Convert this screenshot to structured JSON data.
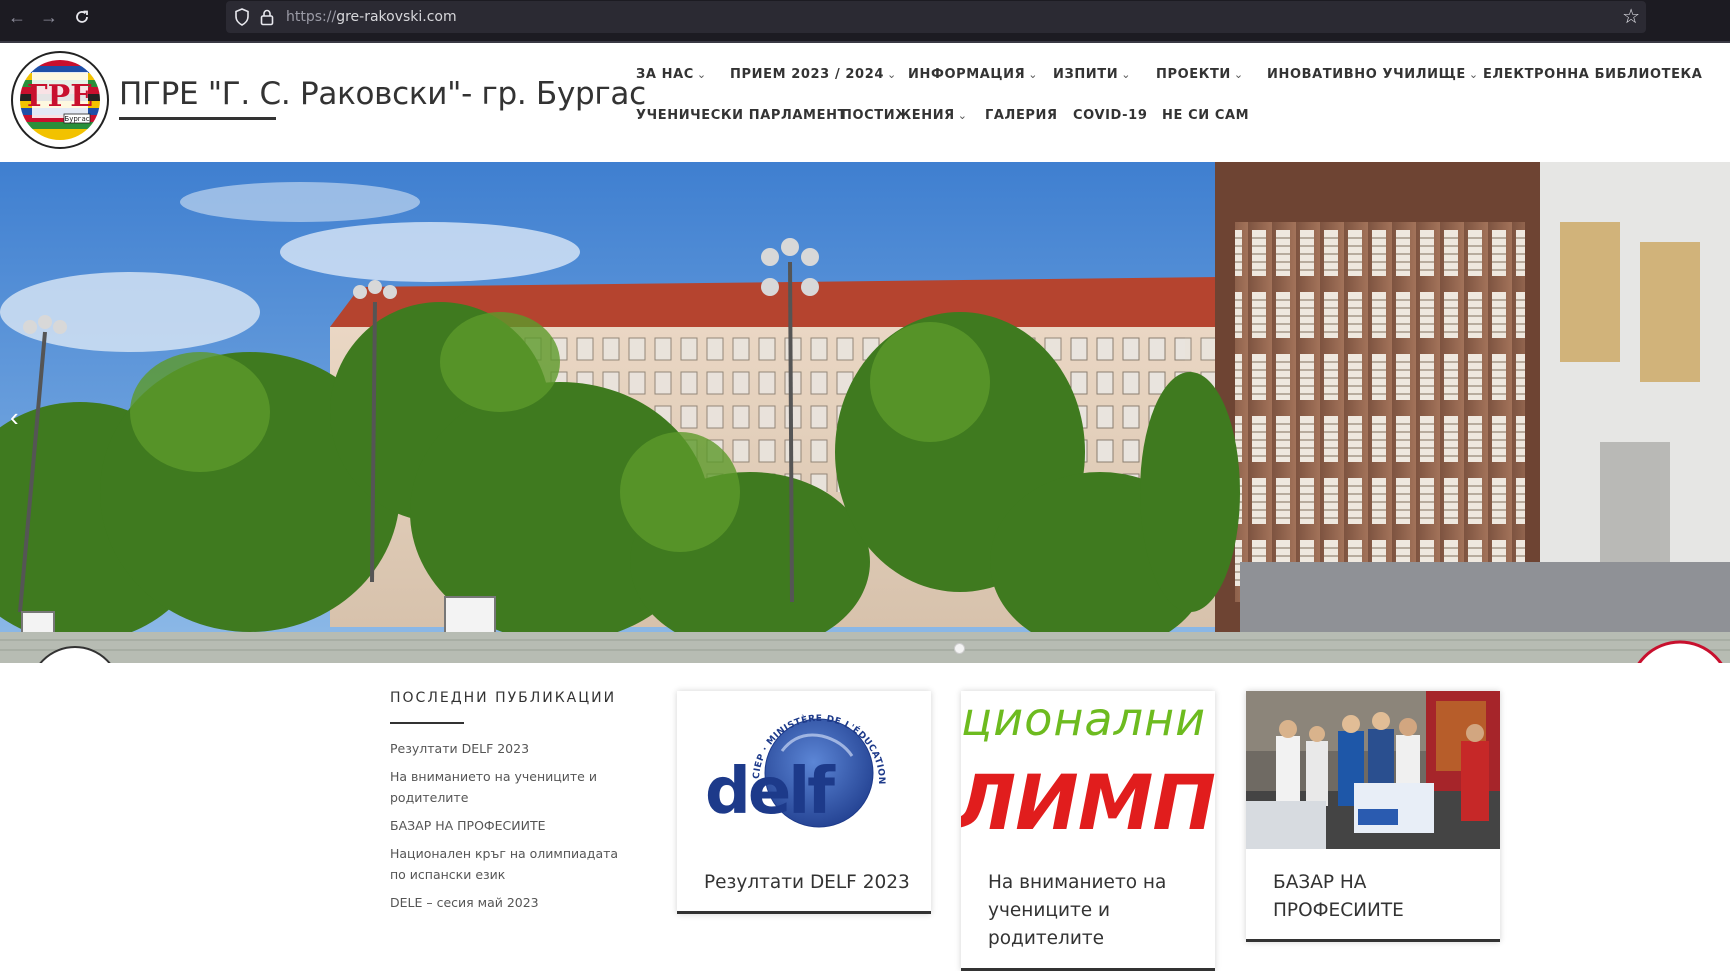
{
  "browser": {
    "url_protocol": "https://",
    "url_domain": "gre-rakovski.com",
    "icons": {
      "back": "arrow-left-icon",
      "forward": "arrow-right-icon",
      "reload": "reload-icon",
      "shield": "shield-icon",
      "lock": "lock-icon",
      "bookmark": "star-icon"
    }
  },
  "site": {
    "title": "ПГРЕ \"Г. С. Раковски\"- гр. Бургас",
    "logo_alt": "Гимназия за Романски Езици \"Георги С. Раковски\" Бургас"
  },
  "menu": {
    "row1": [
      {
        "label": "ЗА НАС",
        "dropdown": true
      },
      {
        "label": "ПРИЕМ 2023 / 2024",
        "dropdown": true
      },
      {
        "label": "ИНФОРМАЦИЯ",
        "dropdown": true
      },
      {
        "label": "ИЗПИТИ",
        "dropdown": true
      },
      {
        "label": "ПРОЕКТИ",
        "dropdown": true
      },
      {
        "label": "ИНОВАТИВНО УЧИЛИЩЕ",
        "dropdown": true
      },
      {
        "label": "ЕЛЕКТРОННА БИБЛИОТЕКА",
        "dropdown": false
      }
    ],
    "row2": [
      {
        "label": "УЧЕНИЧЕСКИ ПАРЛАМЕНТ",
        "dropdown": false
      },
      {
        "label": "ПОСТИЖЕНИЯ",
        "dropdown": true
      },
      {
        "label": "ГАЛЕРИЯ",
        "dropdown": false
      },
      {
        "label": "COVID-19",
        "dropdown": false
      },
      {
        "label": "НЕ СИ САМ",
        "dropdown": false
      }
    ],
    "caret": "⌄"
  },
  "hero": {
    "prev_arrow": "‹",
    "slide_count": 1,
    "active_slide": 1
  },
  "recent_posts": {
    "heading": "ПОСЛЕДНИ ПУБЛИКАЦИИ",
    "items": [
      "Резултати DELF 2023",
      "На вниманието на учениците и родителите",
      "БАЗАР НА ПРОФЕСИИТЕ",
      "Национален кръг на олимпиадата по испански език",
      "DELE – сесия май 2023"
    ]
  },
  "cards": [
    {
      "caption": "Резултати DELF 2023",
      "thumb": "delf",
      "thumb_text": "delf",
      "thumb_ring_text": "CIEP · MINISTÈRE DE L'ÉDUCATION · FRANCE ®"
    },
    {
      "caption": "На вниманието на учениците и родителите",
      "thumb": "olympiad",
      "thumb_text_top": "ционални",
      "thumb_text_bottom": "ЛИМПИАД"
    },
    {
      "caption": "БАЗАР НА ПРОФЕСИИТЕ",
      "thumb": "photo"
    }
  ],
  "colors": {
    "chrome_bg": "#1c1b22",
    "urlbar_bg": "#2b2a33",
    "text_dark": "#333333",
    "delf_blue": "#1d3a8a",
    "olympiad_green": "#6dbb1f",
    "olympiad_red": "#e11d1d"
  }
}
